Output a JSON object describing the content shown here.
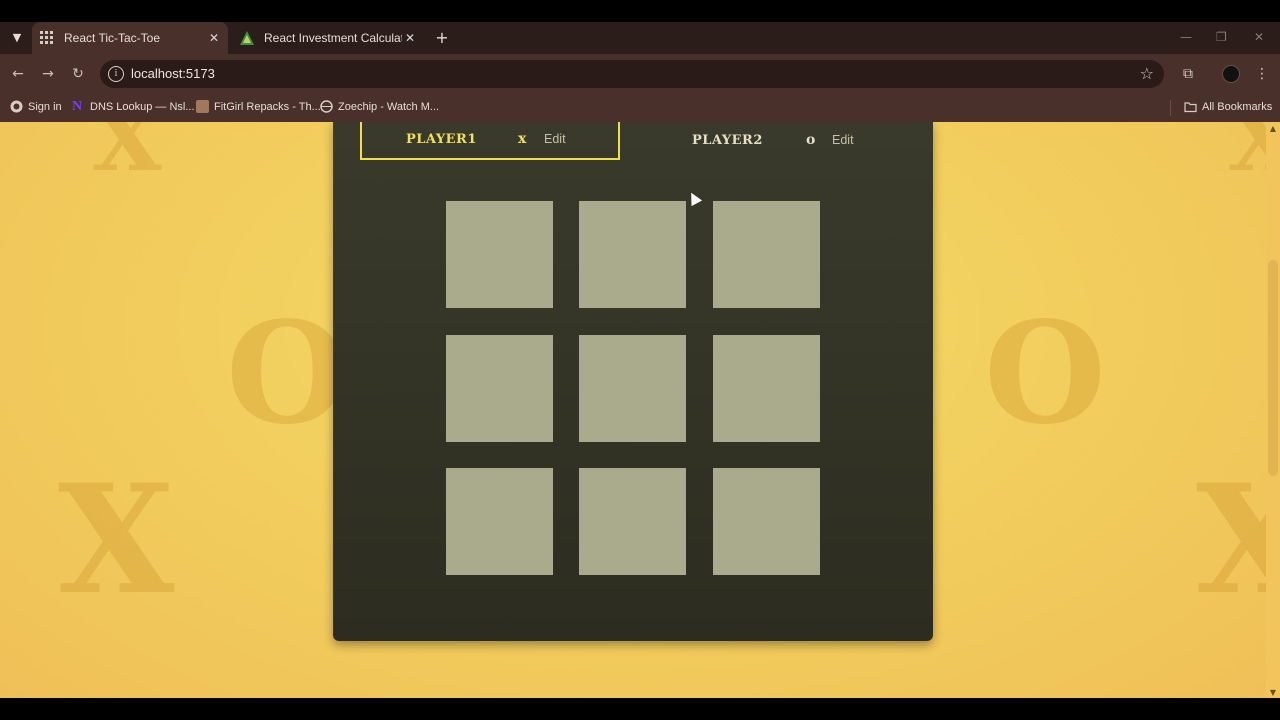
{
  "browser": {
    "tabs": [
      {
        "title": "React Tic-Tac-Toe",
        "active": true,
        "close": "✕"
      },
      {
        "title": "React Investment Calculator",
        "active": false,
        "close": "✕"
      }
    ],
    "new_tab": "+",
    "url": "localhost:5173",
    "bookmarks": [
      {
        "label": "Sign in",
        "icon": "globe-icon"
      },
      {
        "label": "DNS Lookup — Nsl...",
        "icon": "n-logo-icon"
      },
      {
        "label": "FitGirl Repacks - Th...",
        "icon": "site-thumb-icon"
      },
      {
        "label": "Zoechip - Watch M...",
        "icon": "globe-icon"
      }
    ],
    "all_bookmarks": "All Bookmarks"
  },
  "game": {
    "players": [
      {
        "name": "Player1",
        "symbol": "X",
        "edit": "Edit",
        "active": true
      },
      {
        "name": "Player2",
        "symbol": "O",
        "edit": "Edit",
        "active": false
      }
    ],
    "board": [
      [
        "",
        "",
        ""
      ],
      [
        "",
        "",
        ""
      ],
      [
        "",
        "",
        ""
      ]
    ]
  },
  "background_glyphs": [
    "X",
    "O",
    "X",
    "X",
    "O",
    "X"
  ],
  "colors": {
    "page_bg": "#f2cf5e",
    "game_bg": "#2f2f22",
    "cell": "#aaaa8c",
    "active_accent": "#f2de4a"
  }
}
